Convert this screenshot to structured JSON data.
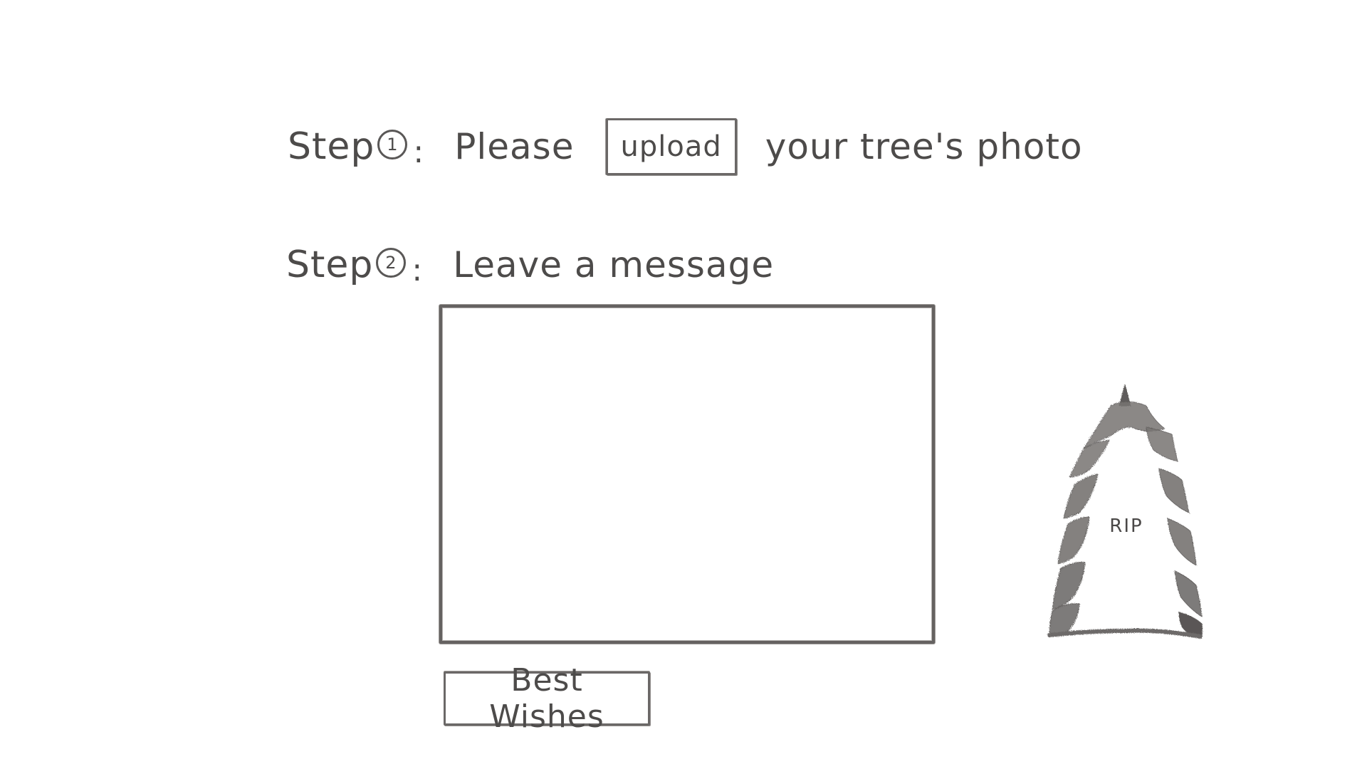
{
  "step1": {
    "step_word": "Step",
    "step_number": "1",
    "colon": ":",
    "prefix_text": "Please",
    "upload_label": "upload",
    "suffix_text": "your tree's photo"
  },
  "step2": {
    "step_word": "Step",
    "step_number": "2",
    "colon": ":",
    "text": "Leave a message"
  },
  "message_box": {
    "value": "",
    "placeholder": ""
  },
  "submit": {
    "label": "Best Wishes"
  },
  "tree_illustration": {
    "icon": "pine-tree-icon",
    "label": "RIP"
  },
  "colors": {
    "ink": "#4d4b4a",
    "border": "#656261",
    "background": "#ffffff"
  }
}
